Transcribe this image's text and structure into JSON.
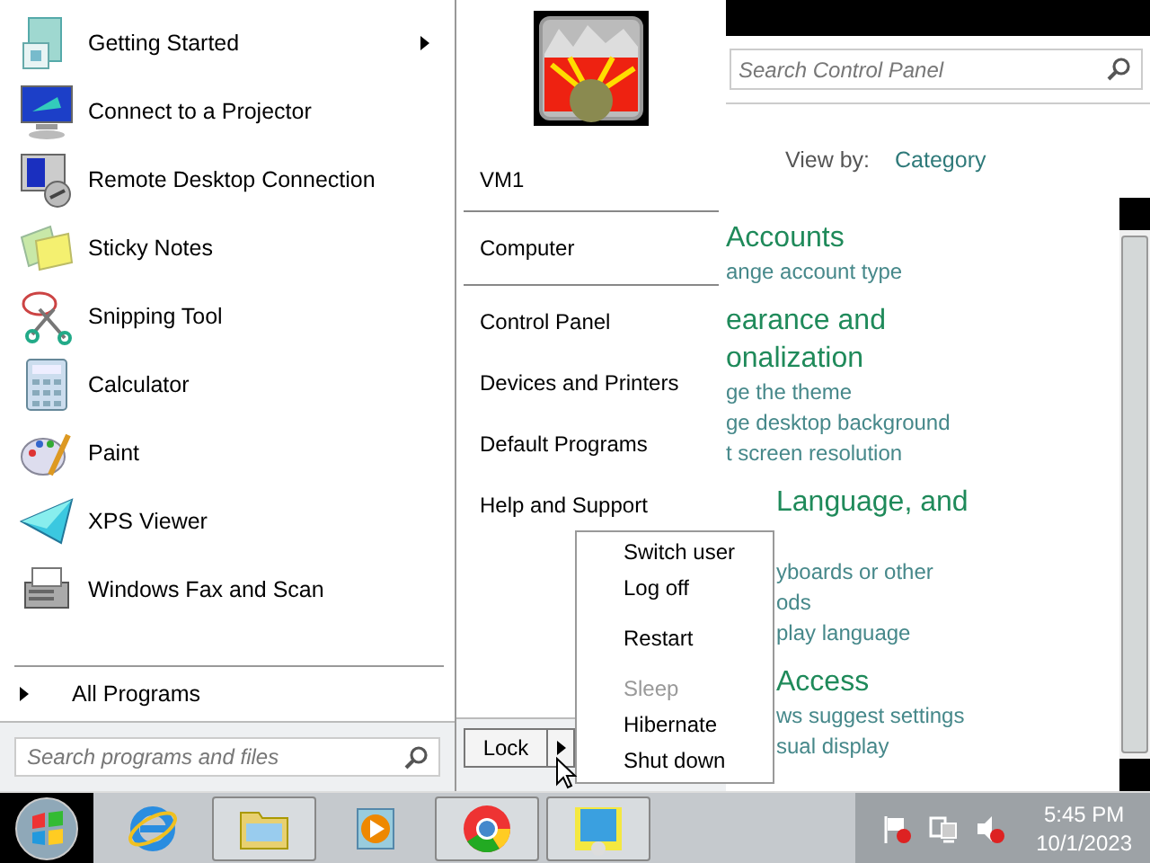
{
  "start_menu": {
    "programs": [
      {
        "label": "Getting Started",
        "submenu": true
      },
      {
        "label": "Connect to a Projector",
        "submenu": false
      },
      {
        "label": "Remote Desktop Connection",
        "submenu": false
      },
      {
        "label": "Sticky Notes",
        "submenu": false
      },
      {
        "label": "Snipping Tool",
        "submenu": false
      },
      {
        "label": "Calculator",
        "submenu": false
      },
      {
        "label": "Paint",
        "submenu": false
      },
      {
        "label": "XPS Viewer",
        "submenu": false
      },
      {
        "label": "Windows Fax and Scan",
        "submenu": false
      }
    ],
    "all_programs": "All Programs",
    "search": {
      "placeholder": "Search programs and files"
    },
    "user": "VM1",
    "place_groups": [
      {
        "items": [
          "Computer"
        ]
      },
      {
        "items": [
          "Control Panel",
          "Devices and Printers",
          "Default Programs",
          "Help and Support"
        ]
      }
    ],
    "lock_button": "Lock"
  },
  "power_menu": {
    "groups": [
      {
        "items": [
          {
            "label": "Switch user",
            "disabled": false
          },
          {
            "label": "Log off",
            "disabled": false
          }
        ]
      },
      {
        "items": [
          {
            "label": "Restart",
            "disabled": false
          }
        ]
      },
      {
        "items": [
          {
            "label": "Sleep",
            "disabled": true
          },
          {
            "label": "Hibernate",
            "disabled": false
          },
          {
            "label": "Shut down",
            "disabled": false
          }
        ]
      }
    ]
  },
  "control_panel": {
    "search": {
      "placeholder": "Search Control Panel"
    },
    "view_by_label": "View by:",
    "view_by_value": "Category",
    "categories": [
      {
        "title_lines": [
          "Accounts"
        ],
        "links": [
          "ange account type"
        ]
      },
      {
        "title_lines": [
          "earance and",
          "onalization"
        ],
        "links": [
          "ge the theme",
          "ge desktop background",
          "t screen resolution"
        ]
      },
      {
        "title_lines": [
          "Language, and"
        ],
        "links": [
          "yboards or other",
          "ods",
          "play language"
        ]
      },
      {
        "title_lines": [
          "Access"
        ],
        "links": [
          "ws suggest settings",
          "sual display"
        ]
      }
    ]
  },
  "taskbar": {
    "clock": {
      "time": "5:45 PM",
      "date": "10/1/2023"
    }
  }
}
